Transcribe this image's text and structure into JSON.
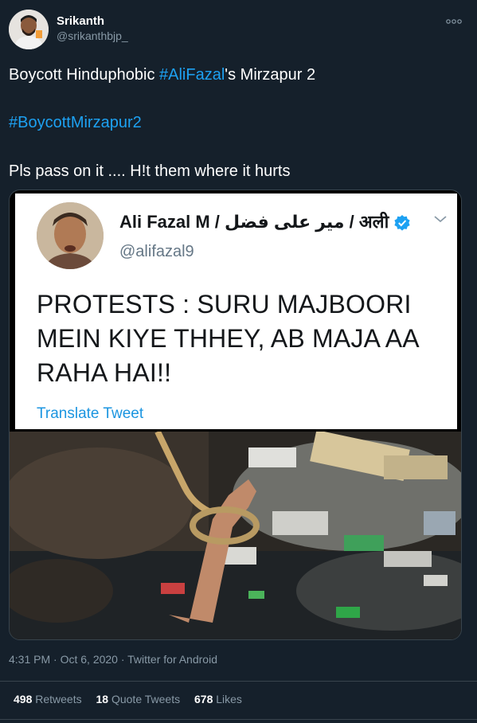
{
  "author": {
    "display_name": "Srikanth",
    "handle": "@srikanthbjp_"
  },
  "tweet": {
    "line1_prefix": "Boycott Hinduphobic ",
    "line1_hashtag": "#AliFazal",
    "line1_suffix": "'s Mirzapur 2",
    "line2_hashtag": "#BoycottMirzapur2",
    "line3": "Pls pass on it .... H!t them where it hurts"
  },
  "embedded_tweet": {
    "display_name": "Ali Fazal M / میر علی فضل / अली",
    "handle": "@alifazal9",
    "text": "PROTESTS : SURU MAJBOORI MEIN KIYE THHEY, AB MAJA AA RAHA HAI!!",
    "translate_label": "Translate Tweet"
  },
  "meta": {
    "time": "4:31 PM · Oct 6, 2020 · Twitter for Android"
  },
  "stats": {
    "retweets_count": "498",
    "retweets_label": "Retweets",
    "quote_count": "18",
    "quote_label": "Quote Tweets",
    "likes_count": "678",
    "likes_label": "Likes"
  },
  "icons": {
    "more": "more-icon",
    "verified": "verified-badge-icon",
    "chevron": "chevron-down-icon"
  },
  "colors": {
    "background": "#15202b",
    "accent": "#1da1f2",
    "muted": "#8899a6"
  }
}
